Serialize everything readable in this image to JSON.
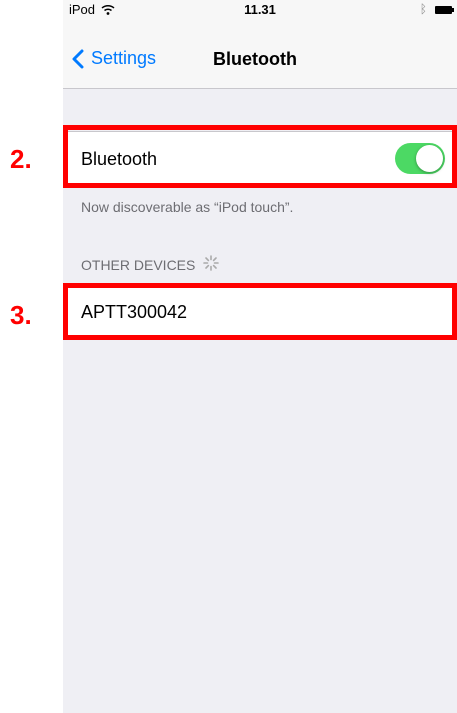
{
  "status_bar": {
    "carrier": "iPod",
    "time": "11.31"
  },
  "nav": {
    "back_label": "Settings",
    "title": "Bluetooth"
  },
  "bluetooth_row": {
    "label": "Bluetooth",
    "toggle_on": true
  },
  "discoverable_text": "Now discoverable as “iPod touch”.",
  "other_devices": {
    "header": "OTHER DEVICES",
    "items": [
      {
        "name": "APTT300042"
      }
    ]
  },
  "annotations": {
    "step_2": "2.",
    "step_3": "3."
  },
  "colors": {
    "accent": "#007aff",
    "toggle_on": "#4cd964",
    "highlight": "#ff0000"
  }
}
